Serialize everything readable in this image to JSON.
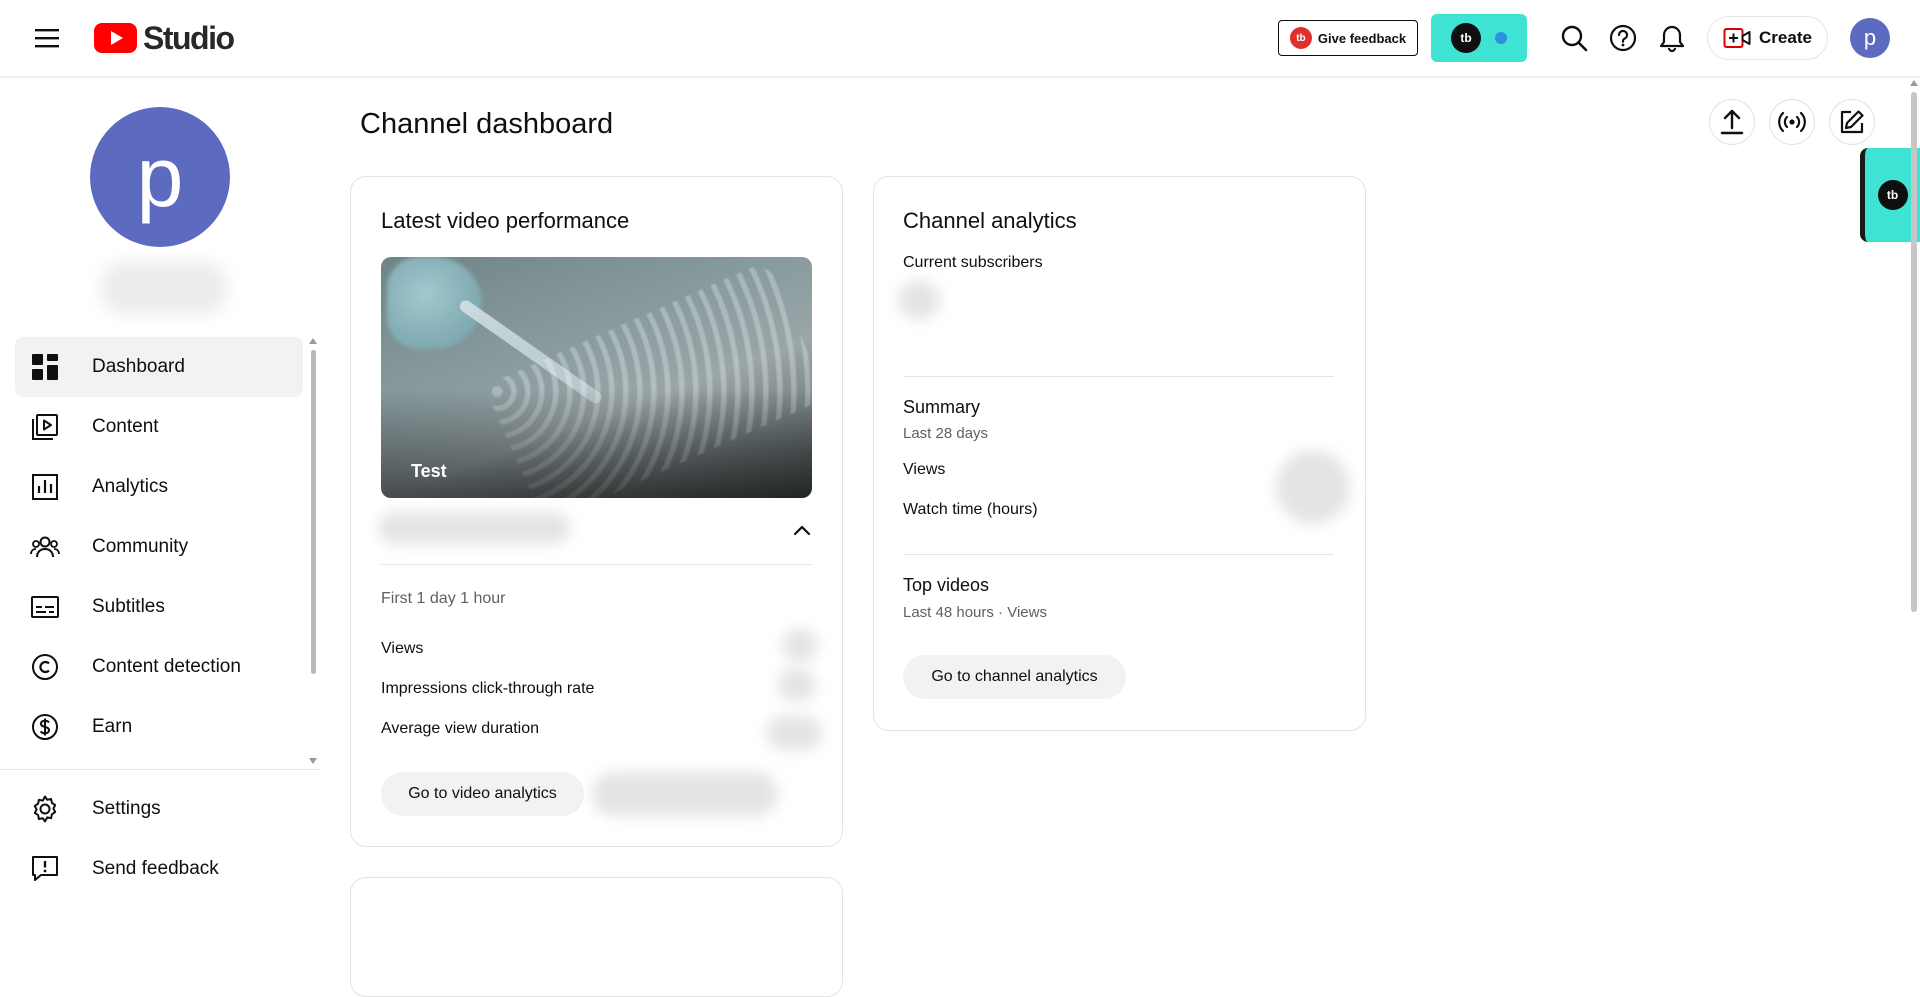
{
  "app": {
    "logo_text": "Studio",
    "brand_color": "#ff0000"
  },
  "header": {
    "give_feedback_label": "Give feedback",
    "tb_badge": "tb",
    "create_label": "Create",
    "avatar_letter": "p"
  },
  "sidebar": {
    "avatar_letter": "p",
    "items": [
      {
        "label": "Dashboard",
        "icon": "dashboard-icon",
        "active": true
      },
      {
        "label": "Content",
        "icon": "content-icon"
      },
      {
        "label": "Analytics",
        "icon": "analytics-icon"
      },
      {
        "label": "Community",
        "icon": "community-icon"
      },
      {
        "label": "Subtitles",
        "icon": "subtitles-icon"
      },
      {
        "label": "Content detection",
        "icon": "copyright-icon"
      },
      {
        "label": "Earn",
        "icon": "earn-icon"
      }
    ],
    "bottom_items": [
      {
        "label": "Settings",
        "icon": "gear-icon"
      },
      {
        "label": "Send feedback",
        "icon": "feedback-icon"
      }
    ]
  },
  "main": {
    "title": "Channel dashboard",
    "latest_video": {
      "title": "Latest video performance",
      "video_title": "Test",
      "period": "First 1 day 1 hour",
      "metrics": [
        "Views",
        "Impressions click-through rate",
        "Average view duration"
      ],
      "button_label": "Go to video analytics"
    },
    "channel_analytics": {
      "title": "Channel analytics",
      "current_subscribers_label": "Current subscribers",
      "summary_title": "Summary",
      "summary_period": "Last 28 days",
      "summary_metrics": [
        "Views",
        "Watch time (hours)"
      ],
      "top_videos_title": "Top videos",
      "top_videos_period": "Last 48 hours · Views",
      "button_label": "Go to channel analytics"
    }
  }
}
